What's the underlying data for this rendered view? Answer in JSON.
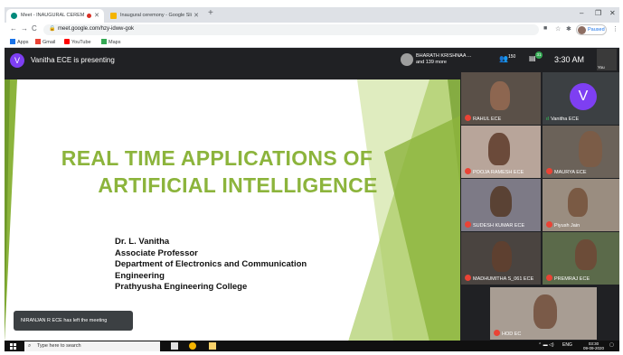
{
  "browser": {
    "tabs": [
      {
        "title": "Meet - INAUGURAL CEREM",
        "favicon_color": "#00897b"
      },
      {
        "title": "Inaugural ceremony - Google Sli",
        "favicon_color": "#f4b400"
      }
    ],
    "new_tab": "+",
    "window_controls": {
      "minimize": "–",
      "restore": "❐",
      "close": "✕"
    },
    "url": "meet.google.com/hzy-idww-gok",
    "profile_status": "Paused"
  },
  "bookmarks": [
    {
      "label": "Apps",
      "color": "#1a73e8"
    },
    {
      "label": "Gmail",
      "color": "#ea4335"
    },
    {
      "label": "YouTube",
      "color": "#ff0000"
    },
    {
      "label": "Maps",
      "color": "#34a853"
    }
  ],
  "meet": {
    "presenter_initial": "V",
    "presenter_text": "Vanitha ECE is presenting",
    "host_line1": "BHARATH KRISHNAA ...",
    "host_line2": "and 139 more",
    "participant_count": "150",
    "chat_badge": "31",
    "time": "3:30 AM",
    "self_label": "You"
  },
  "slide": {
    "title_line1": "REAL TIME APPLICATIONS OF",
    "title_line2": "ARTIFICIAL INTELLIGENCE",
    "author_lines": [
      "Dr. L. Vanitha",
      "Associate Professor",
      "Department of Electronics and Communication",
      "Engineering",
      "Prathyusha Engineering College"
    ],
    "accent_color": "#8cb43c"
  },
  "participants": [
    {
      "name": "RAHUL ECE",
      "muted": true
    },
    {
      "name": "Vanitha ECE",
      "muted": false,
      "initial": "V"
    },
    {
      "name": "POOJA RAMESH ECE",
      "muted": true
    },
    {
      "name": "MAURYA ECE",
      "muted": true
    },
    {
      "name": "SUDESH KUMAR ECE",
      "muted": true
    },
    {
      "name": "Piyush Jain",
      "muted": true
    },
    {
      "name": "MADHUMITHA S_061 ECE",
      "muted": true
    },
    {
      "name": "PREMRAJ ECE",
      "muted": true
    },
    {
      "name": "HOD EC",
      "muted": true
    }
  ],
  "toast": "NIRANJAN R ECE has left the meeting",
  "taskbar": {
    "search_placeholder": "Type here to search",
    "tray_lang": "ENG",
    "clock_time": "03:30",
    "clock_date": "09-09-2020"
  }
}
